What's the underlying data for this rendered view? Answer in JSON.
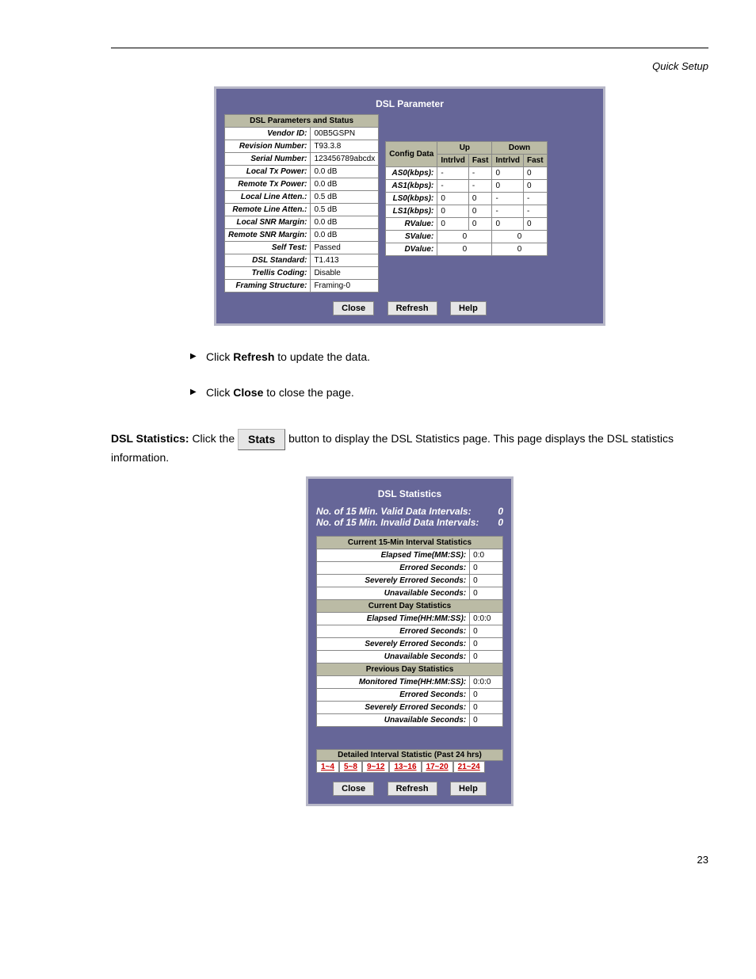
{
  "page_header_right": "Quick Setup",
  "dsl_param": {
    "title": "DSL Parameter",
    "left_header": "DSL Parameters and Status",
    "rows": [
      {
        "label": "Vendor ID:",
        "value": "00B5GSPN"
      },
      {
        "label": "Revision Number:",
        "value": "T93.3.8"
      },
      {
        "label": "Serial Number:",
        "value": "123456789abcdx"
      },
      {
        "label": "Local Tx Power:",
        "value": "0.0 dB"
      },
      {
        "label": "Remote Tx Power:",
        "value": "0.0 dB"
      },
      {
        "label": "Local Line Atten.:",
        "value": "0.5 dB"
      },
      {
        "label": "Remote Line Atten.:",
        "value": "0.5 dB"
      },
      {
        "label": "Local SNR Margin:",
        "value": "0.0 dB"
      },
      {
        "label": "Remote SNR Margin:",
        "value": "0.0 dB"
      },
      {
        "label": "Self Test:",
        "value": "Passed"
      },
      {
        "label": "DSL Standard:",
        "value": "T1.413"
      },
      {
        "label": "Trellis Coding:",
        "value": "Disable"
      },
      {
        "label": "Framing Structure:",
        "value": "Framing-0"
      }
    ],
    "right_header": "Config Data",
    "col_up": "Up",
    "col_down": "Down",
    "col_intrlvd": "Intrlvd",
    "col_fast": "Fast",
    "data_rows": [
      {
        "label": "AS0(kbps):",
        "v": [
          "-",
          "-",
          "0",
          "0"
        ]
      },
      {
        "label": "AS1(kbps):",
        "v": [
          "-",
          "-",
          "0",
          "0"
        ]
      },
      {
        "label": "LS0(kbps):",
        "v": [
          "0",
          "0",
          "-",
          "-"
        ]
      },
      {
        "label": "LS1(kbps):",
        "v": [
          "0",
          "0",
          "-",
          "-"
        ]
      },
      {
        "label": "RValue:",
        "v": [
          "0",
          "0",
          "0",
          "0"
        ]
      }
    ],
    "span_rows": [
      {
        "label": "SValue:",
        "up": "0",
        "down": "0"
      },
      {
        "label": "DValue:",
        "up": "0",
        "down": "0"
      }
    ],
    "btn_close": "Close",
    "btn_refresh": "Refresh",
    "btn_help": "Help"
  },
  "bullets": {
    "item1a": "Click ",
    "item1b": " to update the data.",
    "item2a": "Click ",
    "item2b": " to close the page."
  },
  "bold_refresh": "Refresh",
  "bold_close": "Close",
  "stats_heading": "DSL Statistics:",
  "stats_desc_a": "Click the ",
  "stats_icon_label": "Stats",
  "stats_desc_b": " button to display the DSL Statistics page. This page displays the DSL statistics information.",
  "dsl_stats": {
    "title": "DSL Statistics",
    "line1_label": "No. of 15 Min. Valid Data Intervals:",
    "line1_val": "0",
    "line2_label": "No. of 15 Min. Invalid Data Intervals:",
    "line2_val": "0",
    "sections": [
      {
        "header": "Current 15-Min Interval Statistics",
        "rows": [
          {
            "label": "Elapsed Time(MM:SS):",
            "value": "0:0"
          },
          {
            "label": "Errored Seconds:",
            "value": "0"
          },
          {
            "label": "Severely Errored Seconds:",
            "value": "0"
          },
          {
            "label": "Unavailable Seconds:",
            "value": "0"
          }
        ]
      },
      {
        "header": "Current Day Statistics",
        "rows": [
          {
            "label": "Elapsed Time(HH:MM:SS):",
            "value": "0:0:0"
          },
          {
            "label": "Errored Seconds:",
            "value": "0"
          },
          {
            "label": "Severely Errored Seconds:",
            "value": "0"
          },
          {
            "label": "Unavailable Seconds:",
            "value": "0"
          }
        ]
      },
      {
        "header": "Previous Day Statistics",
        "rows": [
          {
            "label": "Monitored Time(HH:MM:SS):",
            "value": "0:0:0"
          },
          {
            "label": "Errored Seconds:",
            "value": "0"
          },
          {
            "label": "Severely Errored Seconds:",
            "value": "0"
          },
          {
            "label": "Unavailable Seconds:",
            "value": "0"
          }
        ]
      }
    ],
    "detailed_title": "Detailed Interval Statistic (Past 24 hrs)",
    "ranges": [
      "1~4",
      "5~8",
      "9~12",
      "13~16",
      "17~20",
      "21~24"
    ],
    "btn_close": "Close",
    "btn_refresh": "Refresh",
    "btn_help": "Help"
  },
  "page_no": "23"
}
